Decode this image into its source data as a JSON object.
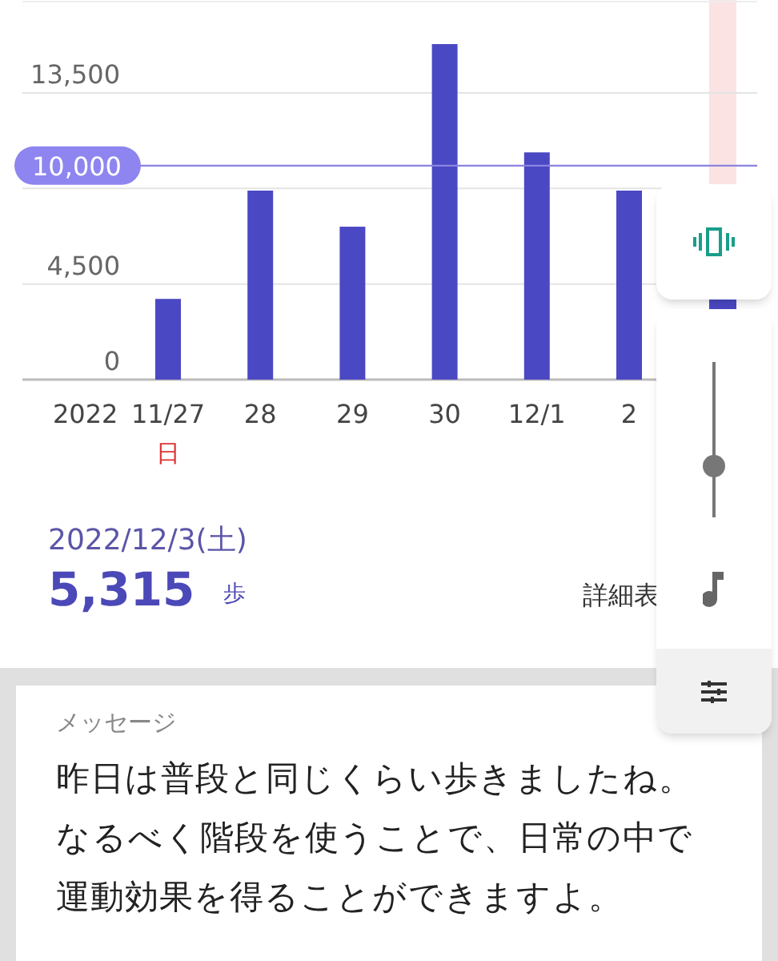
{
  "chart": {
    "year_label": "2022",
    "weekday_label": "日",
    "chart_data": {
      "type": "bar",
      "categories": [
        "11/27",
        "28",
        "29",
        "30",
        "12/1",
        "2"
      ],
      "series": [
        {
          "color": "#4b48c4",
          "values": [
            3800,
            8900,
            7200,
            15800,
            10700,
            8900
          ]
        }
      ],
      "ylim": [
        0,
        17800
      ],
      "yticks": [
        {
          "value": 0,
          "label": "0"
        },
        {
          "value": 4500,
          "label": "4,500"
        },
        {
          "value": 13500,
          "label": "13,500"
        }
      ],
      "ref_lines": [
        {
          "axis": "y",
          "value": 10000,
          "label": "10,000"
        }
      ]
    }
  },
  "day": {
    "date": "2022/12/3(土)",
    "steps": "5,315",
    "unit": "歩",
    "detail_link": "詳細表"
  },
  "message": {
    "title": "メッセージ",
    "lines": [
      "昨日は普段と同じくらい歩きましたね。",
      "なるべく階段を使うことで、日常の中で",
      "運動効果を得ることができますよ。"
    ]
  },
  "volume_panel": {
    "vibrate": true,
    "level": 0.33
  }
}
